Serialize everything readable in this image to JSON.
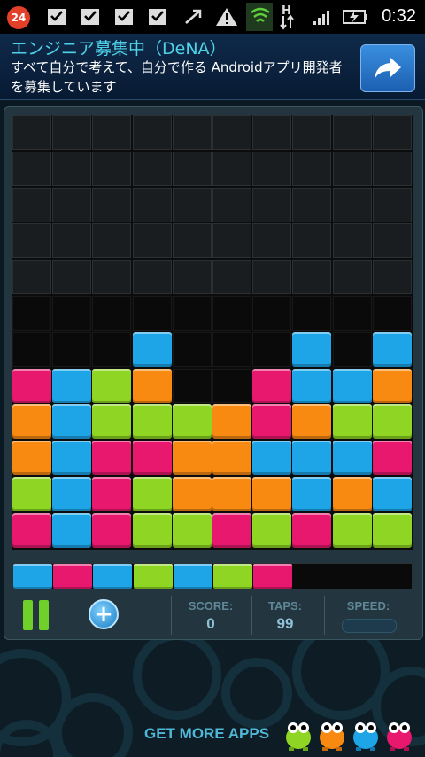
{
  "status_bar": {
    "notification_count": "24",
    "time": "0:32",
    "network_label": "H"
  },
  "ad": {
    "title": "エンジニア募集中（DeNA）",
    "text": "すべて自分で考えて、自分で作る Androidアプリ開発者を募集しています",
    "button_icon": "share-arrow-icon"
  },
  "game": {
    "colors": {
      "B": "#1ea5e8",
      "M": "#e8186f",
      "G": "#8fd624",
      "O": "#f88a12"
    },
    "board_rows": [
      "..........",
      "..........",
      "..........",
      "..........",
      "..........",
      "..........",
      "...B...B.B",
      "MBGO..MBBO",
      "OBGGGOMOGG",
      "OBMMOOBBBM",
      "GBMGOOOBOB",
      "MBMGGMGMGG"
    ],
    "next_row": "BMBGBGM..."
  },
  "controls": {
    "pause_icon": "pause-icon",
    "add_icon": "plus-icon",
    "score_label": "SCORE:",
    "score_value": "0",
    "taps_label": "TAPS:",
    "taps_value": "99",
    "speed_label": "SPEED:"
  },
  "footer": {
    "get_more_label": "GET MORE APPS"
  }
}
